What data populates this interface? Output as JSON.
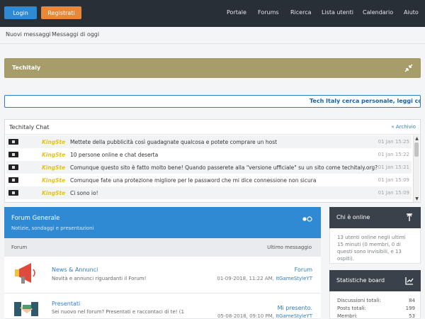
{
  "header": {
    "login_label": "Login",
    "register_label": "Registrati",
    "nav": [
      "Portale",
      "Forums",
      "Ricerca",
      "Lista utenti",
      "Calendario",
      "Aiuto"
    ]
  },
  "subnav": {
    "new_posts": "Nuovi messaggi",
    "today_posts": "Messaggi di oggi"
  },
  "banner": {
    "title": "Techitaly"
  },
  "marquee": {
    "text": "Tech Italy cerca personale, leggi come di"
  },
  "chat": {
    "title": "Techitaly Chat",
    "archive_label": "« Archivio",
    "messages": [
      {
        "user": "KingSte",
        "text": "Mettete della pubblicità così guadagnate qualcosa e potete comprare un host",
        "time": "01 Jan 15:25"
      },
      {
        "user": "KingSte",
        "text": "10 persone online e chat deserta",
        "time": "01 Jan 15:22"
      },
      {
        "user": "KingSte",
        "text": "Comunque questo sito è fatto molto bene! Quando passerete alla \"versione ufficiale\" su un sito come techitaly.org?",
        "time": "01 Jan 15:21"
      },
      {
        "user": "KingSte",
        "text": "Comunque fate una protezione migliore per le password che mi dice connessione non sicura",
        "time": "01 Jan 15:09"
      },
      {
        "user": "KingSte",
        "text": "Ci sono io!",
        "time": "01 Jan 15:09"
      }
    ]
  },
  "forum": {
    "category_title": "Forum Generale",
    "category_desc": "Notizie, sondaggi e presentazioni",
    "col_forum": "Forum",
    "col_last": "Ultimo messaggio",
    "rows": [
      {
        "name": "News & Annunci",
        "desc": "Novità e annunci riguardanti il Forum!",
        "last_title": "Forum",
        "last_date": "01-09-2018, 11:22 AM,",
        "last_user": "ItGameStyleYT"
      },
      {
        "name": "Presentati",
        "desc": "Sei nuovo nel forum? Presentati e raccontaci di te! (1",
        "last_title": "Mi presento.",
        "last_date": "05-08-2018, 09:10 PM,",
        "last_user": "ItGameStyleYT"
      }
    ]
  },
  "sidebar": {
    "online_title": "Chi è online",
    "online_text": "13 utenti online negli ultimi 15 minuti (0 membri, 0 di questi sono invisibili, e 13 ospiti).",
    "stats_title": "Statistiche board",
    "stats": [
      {
        "label": "Discussioni totali:",
        "value": "84"
      },
      {
        "label": "Posts totali:",
        "value": "199"
      },
      {
        "label": "Membri:",
        "value": "53"
      }
    ]
  },
  "colors": {
    "topbar": "#282f37",
    "login": "#2f8ad3",
    "register": "#e8883a",
    "banner": "#a69d6a",
    "forum_header": "#2f8ad3",
    "sidebar_header": "#39414a",
    "chat_user": "#e3c21b"
  }
}
